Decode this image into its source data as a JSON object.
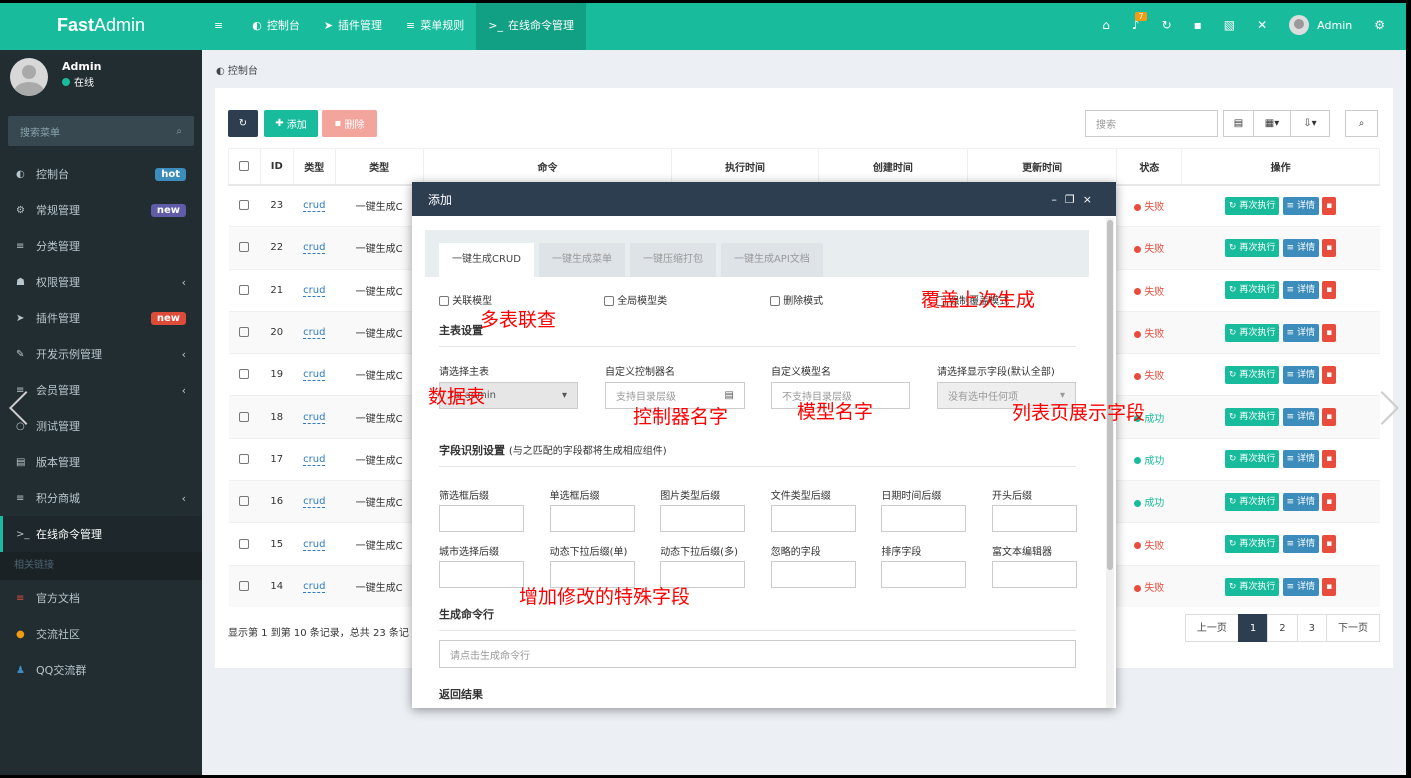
{
  "app": {
    "logo_bold": "Fast",
    "logo_rest": "Admin"
  },
  "topnav": [
    {
      "icon": "≡",
      "label": ""
    },
    {
      "icon": "◐",
      "label": "控制台"
    },
    {
      "icon": "➤",
      "label": "插件管理"
    },
    {
      "icon": "≡",
      "label": "菜单规则"
    },
    {
      "icon": ">_",
      "label": "在线命令管理"
    }
  ],
  "topright": {
    "notify_count": "7",
    "user": "Admin"
  },
  "user": {
    "name": "Admin",
    "status": "在线"
  },
  "sidebar": {
    "search_placeholder": "搜索菜单",
    "items": [
      {
        "icon": "◐",
        "label": "控制台",
        "tag": "hot",
        "tag_color": "#3c8dbc"
      },
      {
        "icon": "⚙",
        "label": "常规管理",
        "tag": "new",
        "tag_color": "#605ca8"
      },
      {
        "icon": "≡",
        "label": "分类管理"
      },
      {
        "icon": "☗",
        "label": "权限管理",
        "chev": "‹"
      },
      {
        "icon": "➤",
        "label": "插件管理",
        "tag": "new",
        "tag_color": "#dd4b39"
      },
      {
        "icon": "✎",
        "label": "开发示例管理",
        "chev": "‹"
      },
      {
        "icon": "≡",
        "label": "会员管理",
        "chev": "‹"
      },
      {
        "icon": "○",
        "label": "测试管理"
      },
      {
        "icon": "▤",
        "label": "版本管理"
      },
      {
        "icon": "≡",
        "label": "积分商城",
        "chev": "‹"
      },
      {
        "icon": ">_",
        "label": "在线命令管理",
        "active": true
      }
    ],
    "section": "相关链接",
    "links": [
      {
        "icon": "≡",
        "label": "官方文档",
        "color": "#dd4b39"
      },
      {
        "icon": "●",
        "label": "交流社区",
        "color": "#f39c12"
      },
      {
        "icon": "♟",
        "label": "QQ交流群",
        "color": "#3c8dbc"
      }
    ]
  },
  "breadcrumb": "控制台",
  "toolbar": {
    "add": "添加",
    "delete": "删除",
    "search_placeholder": "搜索"
  },
  "table": {
    "headers": [
      "ID",
      "类型",
      "类型",
      "命令",
      "执行时间",
      "创建时间",
      "更新时间",
      "状态",
      "操作"
    ],
    "rows": [
      {
        "id": "23",
        "type": "crud",
        "name": "一键生成C",
        "status": "失败"
      },
      {
        "id": "22",
        "type": "crud",
        "name": "一键生成C",
        "status": "失败"
      },
      {
        "id": "21",
        "type": "crud",
        "name": "一键生成C",
        "status": "失败"
      },
      {
        "id": "20",
        "type": "crud",
        "name": "一键生成C",
        "status": "失败"
      },
      {
        "id": "19",
        "type": "crud",
        "name": "一键生成C",
        "status": "失败"
      },
      {
        "id": "18",
        "type": "crud",
        "name": "一键生成C",
        "status": "成功"
      },
      {
        "id": "17",
        "type": "crud",
        "name": "一键生成C",
        "status": "成功"
      },
      {
        "id": "16",
        "type": "crud",
        "name": "一键生成C",
        "status": "成功"
      },
      {
        "id": "15",
        "type": "crud",
        "name": "一键生成C",
        "status": "失败"
      },
      {
        "id": "14",
        "type": "crud",
        "name": "一键生成C",
        "status": "失败"
      }
    ],
    "actions": {
      "rerun": "再次执行",
      "detail": "详情"
    }
  },
  "pagination": {
    "info": "显示第 1 到第 10 条记录，总共 23 条记",
    "prev": "上一页",
    "pages": [
      "1",
      "2",
      "3"
    ],
    "next": "下一页"
  },
  "dialog": {
    "title": "添加",
    "tabs": [
      "一键生成CRUD",
      "一键生成菜单",
      "一键压缩打包",
      "一键生成API文档"
    ],
    "checks": [
      "关联模型",
      "全局模型类",
      "删除模式",
      "强制覆盖模式"
    ],
    "main_section": "主表设置",
    "labels": {
      "table": "请选择主表",
      "controller": "自定义控制器名",
      "model": "自定义模型名",
      "fields": "请选择显示字段(默认全部)"
    },
    "inputs": {
      "table_value": "fa_admin",
      "controller_ph": "支持目录层级",
      "model_ph": "不支持目录层级",
      "fields_ph": "没有选中任何项"
    },
    "field_section": "字段识别设置",
    "field_section_note": "(与之匹配的字段都将生成相应组件)",
    "suffix_labels": [
      "筛选框后缀",
      "单选框后缀",
      "图片类型后缀",
      "文件类型后缀",
      "日期时间后缀",
      "开头后缀",
      "城市选择后缀",
      "动态下拉后缀(单)",
      "动态下拉后缀(多)",
      "忽略的字段",
      "排序字段",
      "富文本编辑器"
    ],
    "cmd_section": "生成命令行",
    "cmd_ph": "请点击生成命令行",
    "result_section": "返回结果"
  },
  "annotations": {
    "multi": "多表联查",
    "table": "数据表",
    "controller": "控制器名字",
    "model": "模型名字",
    "fields": "列表页展示字段",
    "overwrite": "覆盖上次生成",
    "special": "增加修改的特殊字段"
  }
}
